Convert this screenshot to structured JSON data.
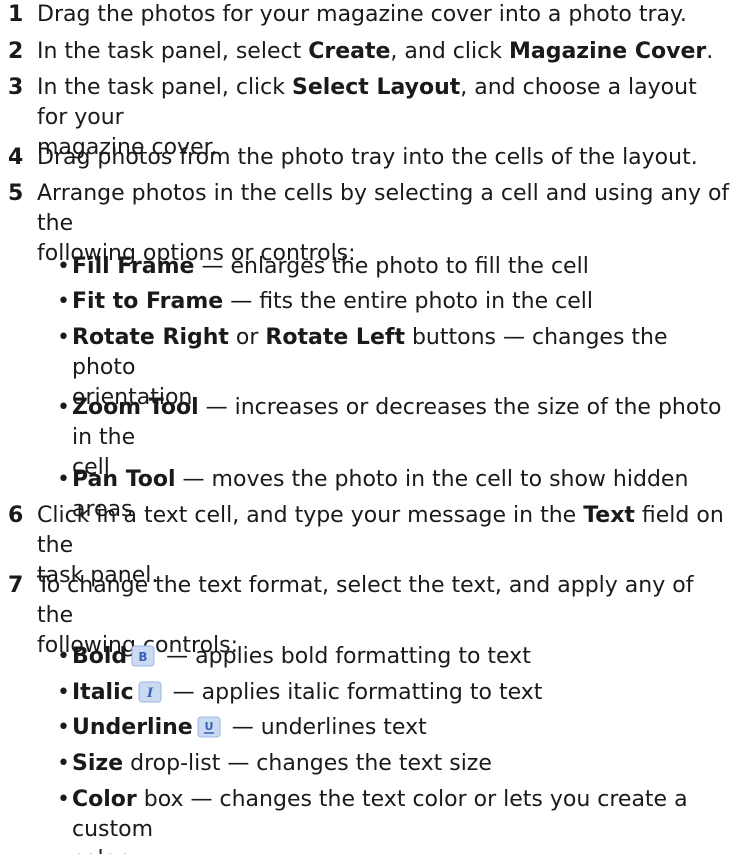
{
  "steps": [
    {
      "num": "1",
      "text": "Drag the photos for your magazine cover into a photo tray."
    },
    {
      "num": "2",
      "pre": "In the task panel, select ",
      "b1": "Create",
      "mid": ", and click ",
      "b2": "Magazine Cover",
      "post": "."
    },
    {
      "num": "3",
      "pre": "In the task panel, click ",
      "b1": "Select Layout",
      "line1rest": ", and choose a layout for your",
      "line2": "magazine cover."
    },
    {
      "num": "4",
      "text": "Drag photos from the photo tray into the cells of the layout."
    },
    {
      "num": "5",
      "line1": "Arrange photos in the cells by selecting a cell and using any of the",
      "line2": "following options or controls:"
    },
    {
      "num": "6",
      "pre": "Click in a text cell, and type your message in the ",
      "b1": "Text",
      "post": " field on the",
      "line2": "task panel."
    },
    {
      "num": "7",
      "line1": "To change the text format, select the text, and apply any of the",
      "line2": "following controls:"
    }
  ],
  "step5_bullets": [
    {
      "bold": "Fill Frame",
      "text": " — enlarges the photo to fill the cell"
    },
    {
      "bold": "Fit to Frame",
      "text": " — fits the entire photo in the cell"
    },
    {
      "bold": "Rotate Right",
      "or": " or ",
      "bold2": "Rotate Left",
      "text": " buttons — changes the photo",
      "line2": "orientation"
    },
    {
      "bold": "Zoom Tool",
      "text": " — increases or decreases the size of the photo in the",
      "line2": "cell"
    },
    {
      "bold": "Pan Tool",
      "text": " — moves the photo in the cell to show hidden areas"
    }
  ],
  "step7_bullets": [
    {
      "bold": "Bold",
      "icon": "bold-icon",
      "text": " — applies bold formatting to text"
    },
    {
      "bold": "Italic",
      "icon": "italic-icon",
      "text": " — applies italic formatting to text"
    },
    {
      "bold": "Underline",
      "icon": "underline-icon",
      "text": " — underlines text"
    },
    {
      "bold": "Size",
      "text": " drop-list — changes the text size"
    },
    {
      "bold": "Color",
      "text": " box — changes the text color or lets you create a custom",
      "line2": "color"
    }
  ],
  "bullet_glyph": "•",
  "colors": {
    "text": "#1a1a1a",
    "icon_bg": "#c9daf2",
    "icon_glyph": "#3b63b8"
  }
}
